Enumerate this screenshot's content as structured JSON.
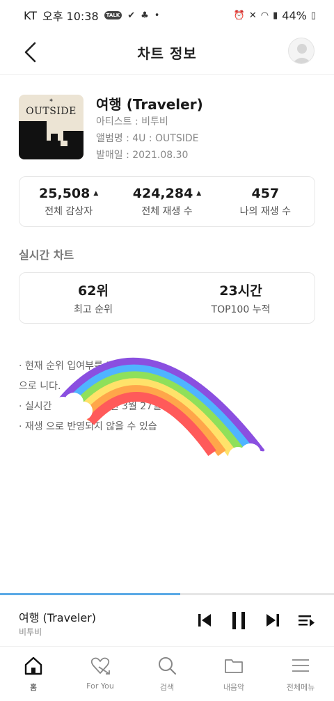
{
  "status_bar": {
    "carrier": "KT",
    "time": "오후 10:38",
    "battery": "44%",
    "talk_badge": "TALK"
  },
  "header": {
    "title": "차트 정보"
  },
  "song": {
    "title": "여행 (Traveler)",
    "artist_line": "아티스트 : 비투비",
    "album_line": "앨범명 : 4U : OUTSIDE",
    "release_line": "발매일 : 2021.08.30",
    "cover_text": "OUTSIDE"
  },
  "stats": [
    {
      "value": "25,508",
      "label": "전체 감상자",
      "trend": "up"
    },
    {
      "value": "424,284",
      "label": "전체 재생 수",
      "trend": "up"
    },
    {
      "value": "457",
      "label": "나의 재생 수",
      "trend": ""
    }
  ],
  "realtime": {
    "section_title": "실시간 차트",
    "items": [
      {
        "value": "62위",
        "label": "최고 순위"
      },
      {
        "value": "23시간",
        "label": "TOP100 누적"
      }
    ]
  },
  "notes": [
    "· 현재 순위                                                    입여부를 기준",
    "   으로                 니다.",
    "· 실시간 차트는 2013년 3월 27일 이후부터                    니다.",
    "· 재생           으로 반영되지 않을 수 있습"
  ],
  "player": {
    "title": "여행 (Traveler)",
    "artist": "비투비",
    "progress": 0.54
  },
  "nav": [
    {
      "label": "홈",
      "icon": "home-icon"
    },
    {
      "label": "For You",
      "icon": "heart-arrow-icon"
    },
    {
      "label": "검색",
      "icon": "search-icon"
    },
    {
      "label": "내음악",
      "icon": "folder-icon"
    },
    {
      "label": "전체메뉴",
      "icon": "menu-icon"
    }
  ],
  "colors": {
    "accent": "#5aa9e6",
    "rainbow": [
      "#ff5a5a",
      "#ffa64a",
      "#ffe26a",
      "#8fe05a",
      "#4fb4ff",
      "#8a4fe0"
    ]
  }
}
